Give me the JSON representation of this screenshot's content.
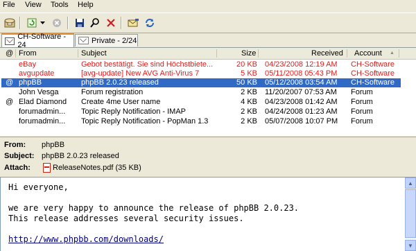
{
  "menu": {
    "file": "File",
    "view": "View",
    "tools": "Tools",
    "help": "Help"
  },
  "toolbar": {
    "icons": [
      "mailbox-icon",
      "refresh-icon",
      "dropdown-arrow-icon",
      "stop-icon",
      "save-icon",
      "search-icon",
      "delete-icon",
      "compose-icon",
      "sync-icon"
    ]
  },
  "tabs": [
    {
      "label": "CH-Software - 24",
      "active": true
    },
    {
      "label": "Private - 2/24",
      "active": false
    }
  ],
  "columns": {
    "attach": "@",
    "from": "From",
    "subject": "Subject",
    "size": "Size",
    "received": "Received",
    "account": "Account"
  },
  "messages": [
    {
      "attach": "",
      "from": "eBay",
      "subject": "Gebot bestätigt. Sie sind Höchstbiete...",
      "size": "20 KB",
      "received": "04/23/2008 12:19 AM",
      "account": "CH-Software",
      "style": "red"
    },
    {
      "attach": "",
      "from": "avgupdate",
      "subject": "[avg-update] New AVG Anti-Virus 7",
      "size": "5 KB",
      "received": "05/11/2008 05:43 PM",
      "account": "CH-Software",
      "style": "red"
    },
    {
      "attach": "@",
      "from": "phpBB",
      "subject": "phpBB 2.0.23 released",
      "size": "50 KB",
      "received": "05/12/2008 03:54 AM",
      "account": "CH-Software",
      "style": "selected"
    },
    {
      "attach": "",
      "from": "John Vesga",
      "subject": "Forum registration",
      "size": "2 KB",
      "received": "11/20/2007 07:53 AM",
      "account": "Forum",
      "style": "normal"
    },
    {
      "attach": "@",
      "from": "Elad Diamond",
      "subject": "Create 4me User name",
      "size": "4 KB",
      "received": "04/23/2008 01:42 AM",
      "account": "Forum",
      "style": "normal"
    },
    {
      "attach": "",
      "from": "forumadmin...",
      "subject": "Topic Reply Notification - IMAP",
      "size": "2 KB",
      "received": "04/24/2008 01:23 AM",
      "account": "Forum",
      "style": "normal"
    },
    {
      "attach": "",
      "from": "forumadmin...",
      "subject": "Topic Reply Notification - PopMan 1.3",
      "size": "2 KB",
      "received": "05/07/2008 10:07 PM",
      "account": "Forum",
      "style": "normal"
    }
  ],
  "header": {
    "from_label": "From:",
    "from_value": "phpBB",
    "subject_label": "Subject:",
    "subject_value": "phpBB 2.0.23 released",
    "attach_label": "Attach:",
    "attach_value": "ReleaseNotes.pdf (35 KB)"
  },
  "body": {
    "line1": "Hi everyone,",
    "line2": "we are very happy to announce the release of phpBB 2.0.23.",
    "line3": "This release addresses several security issues.",
    "link": "http://www.phpbb.com/downloads/"
  },
  "colors": {
    "selected_row": "#316ac5",
    "unread_red": "#e21b1b",
    "tab_accent": "#e68b2c"
  }
}
